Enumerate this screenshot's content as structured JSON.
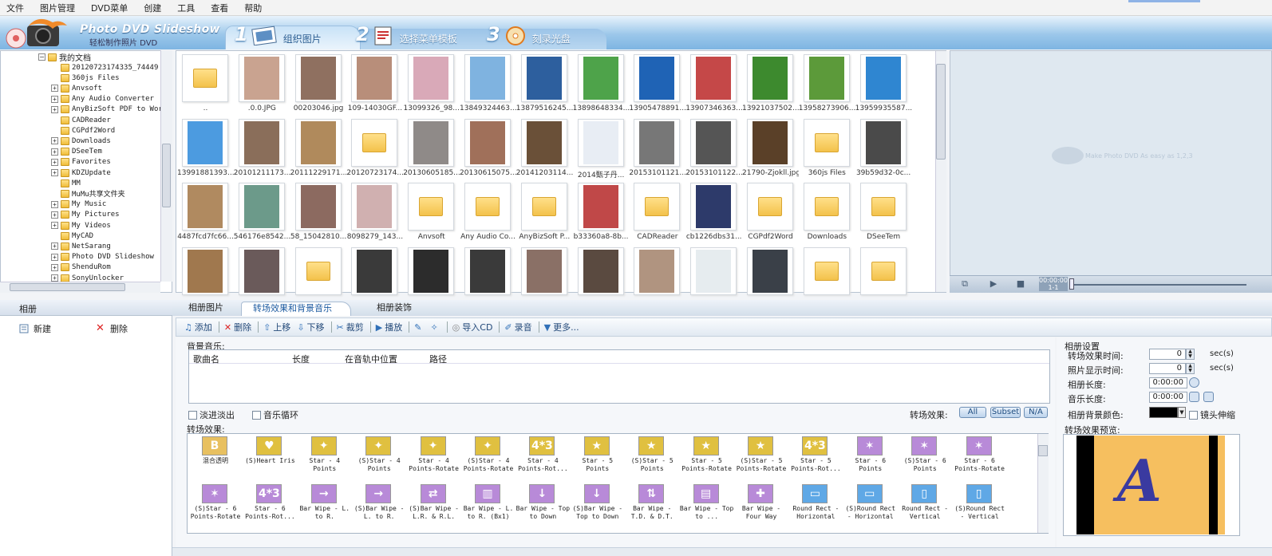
{
  "menu": [
    "文件",
    "图片管理",
    "DVD菜单",
    "创建",
    "工具",
    "查看",
    "帮助"
  ],
  "app": {
    "title": "Photo DVD Slideshow",
    "subtitle": "轻松制作照片 DVD"
  },
  "steps": [
    {
      "num": "1",
      "label": "组织图片"
    },
    {
      "num": "2",
      "label": "选择菜单模板"
    },
    {
      "num": "3",
      "label": "刻录光盘"
    }
  ],
  "tree": {
    "root": "我的文档",
    "items": [
      "20120723174335_74449",
      "360js Files",
      "Anvsoft",
      "Any Audio Converter",
      "AnyBizSoft PDF to Word",
      "CADReader",
      "CGPdf2Word",
      "Downloads",
      "DSeeTem",
      "Favorites",
      "KDZUpdate",
      "MM",
      "MuMu共享文件夹",
      "My Music",
      "My Pictures",
      "My Videos",
      "MyCAD",
      "NetSarang",
      "Photo DVD Slideshow",
      "ShenduRom",
      "SonyUnlocker"
    ]
  },
  "thumbs": [
    {
      "cap": "..",
      "kind": "folder"
    },
    {
      "cap": ".0.0.JPG",
      "kind": "img",
      "color": "#c9a390"
    },
    {
      "cap": "00203046.jpg",
      "kind": "img",
      "color": "#8f7060"
    },
    {
      "cap": "109-14030GF...",
      "kind": "img",
      "color": "#b88e7a"
    },
    {
      "cap": "13099326_98...",
      "kind": "img",
      "color": "#d9a9b8"
    },
    {
      "cap": "13849324463...",
      "kind": "img",
      "color": "#7fb3e0"
    },
    {
      "cap": "13879516245...",
      "kind": "img",
      "color": "#2d5f9e"
    },
    {
      "cap": "13898648334...",
      "kind": "img",
      "color": "#4ea34a"
    },
    {
      "cap": "13905478891...",
      "kind": "img",
      "color": "#1f63b5"
    },
    {
      "cap": "13907346363...",
      "kind": "img",
      "color": "#c54848"
    },
    {
      "cap": "13921037502...",
      "kind": "img",
      "color": "#3d8a2e"
    },
    {
      "cap": "13958273906...",
      "kind": "img",
      "color": "#5c9a3a"
    },
    {
      "cap": "13959935587...",
      "kind": "img",
      "color": "#2f86d1"
    },
    {
      "cap": "13991881393...",
      "kind": "img",
      "color": "#4c9be0"
    },
    {
      "cap": "20101211173...",
      "kind": "img",
      "color": "#8a6e5a"
    },
    {
      "cap": "20111229171...",
      "kind": "img",
      "color": "#b08a5c"
    },
    {
      "cap": "20120723174...",
      "kind": "folder"
    },
    {
      "cap": "20130605185...",
      "kind": "img",
      "color": "#8f8a88"
    },
    {
      "cap": "20130615075...",
      "kind": "img",
      "color": "#a0705a"
    },
    {
      "cap": "20141203114...",
      "kind": "img",
      "color": "#6a5038"
    },
    {
      "cap": "2014甄子丹...",
      "kind": "img",
      "color": "#e8edf4"
    },
    {
      "cap": "20153101121...",
      "kind": "img",
      "color": "#777"
    },
    {
      "cap": "20153101122...",
      "kind": "img",
      "color": "#555"
    },
    {
      "cap": "21790-Zjokll.jpg",
      "kind": "img",
      "color": "#5a4028"
    },
    {
      "cap": "360js Files",
      "kind": "folder"
    },
    {
      "cap": "39b59d32-0c...",
      "kind": "img",
      "color": "#4a4a4a"
    },
    {
      "cap": "4487fcd7fc66...",
      "kind": "img",
      "color": "#b08a60"
    },
    {
      "cap": "546176e8542...",
      "kind": "img",
      "color": "#6c9a8a"
    },
    {
      "cap": "58_15042810...",
      "kind": "img",
      "color": "#8c6a60"
    },
    {
      "cap": "8098279_143...",
      "kind": "img",
      "color": "#d0b0b0"
    },
    {
      "cap": "Anvsoft",
      "kind": "folder"
    },
    {
      "cap": "Any Audio Co...",
      "kind": "folder"
    },
    {
      "cap": "AnyBizSoft P...",
      "kind": "folder"
    },
    {
      "cap": "b33360a8-8b...",
      "kind": "img",
      "color": "#c04848"
    },
    {
      "cap": "CADReader",
      "kind": "folder"
    },
    {
      "cap": "cb1226dbs31...",
      "kind": "img",
      "color": "#2d3a6a"
    },
    {
      "cap": "CGPdf2Word",
      "kind": "folder"
    },
    {
      "cap": "Downloads",
      "kind": "folder"
    },
    {
      "cap": "DSeeTem",
      "kind": "folder"
    },
    {
      "cap": "",
      "kind": "img",
      "color": "#a0784e"
    },
    {
      "cap": "",
      "kind": "img",
      "color": "#6a5a5a"
    },
    {
      "cap": "",
      "kind": "folder"
    },
    {
      "cap": "",
      "kind": "img",
      "color": "#3a3a3a"
    },
    {
      "cap": "",
      "kind": "img",
      "color": "#2c2c2c"
    },
    {
      "cap": "",
      "kind": "img",
      "color": "#3a3a3a"
    },
    {
      "cap": "",
      "kind": "img",
      "color": "#8a7066"
    },
    {
      "cap": "",
      "kind": "img",
      "color": "#5a4a40"
    },
    {
      "cap": "",
      "kind": "img",
      "color": "#b09480"
    },
    {
      "cap": "",
      "kind": "img",
      "color": "#e6ecef"
    },
    {
      "cap": "",
      "kind": "img",
      "color": "#3a4048"
    },
    {
      "cap": "",
      "kind": "folder"
    },
    {
      "cap": "",
      "kind": "folder"
    }
  ],
  "preview": {
    "watermark": "Make Photo DVD As easy as 1,2,3",
    "time": "00:00:00",
    "counter": "1-1"
  },
  "album": {
    "title": "相册",
    "new_label": "新建",
    "delete_label": "删除"
  },
  "tabs": [
    "相册图片",
    "转场效果和背景音乐",
    "相册装饰"
  ],
  "toolbar": [
    "添加",
    "删除",
    "上移",
    "下移",
    "裁剪",
    "播放",
    "导入CD",
    "录音",
    "更多..."
  ],
  "music": {
    "title": "背景音乐:",
    "columns": [
      "歌曲名",
      "长度",
      "在音轨中位置",
      "路径"
    ],
    "fade_label": "淡进淡出",
    "loop_label": "音乐循环",
    "effect_label": "转场效果:",
    "filters": [
      "All",
      "Subset",
      "N/A"
    ]
  },
  "effects": {
    "title": "转场效果:",
    "items": [
      {
        "name": "混合透明",
        "icon": "B",
        "bg": "#e8c060"
      },
      {
        "name": "(S)Heart Iris",
        "icon": "♥",
        "bg": "#e0c040"
      },
      {
        "name": "Star - 4 Points",
        "icon": "✦",
        "bg": "#e0c040"
      },
      {
        "name": "(S)Star - 4 Points",
        "icon": "✦",
        "bg": "#e0c040"
      },
      {
        "name": "Star - 4 Points-Rotate",
        "icon": "✦",
        "bg": "#e0c040"
      },
      {
        "name": "(S)Star - 4 Points-Rotate",
        "icon": "✦",
        "bg": "#e0c040"
      },
      {
        "name": "Star - 4 Points-Rot...",
        "icon": "4*3",
        "bg": "#e0c040"
      },
      {
        "name": "Star - 5 Points",
        "icon": "★",
        "bg": "#e0c040"
      },
      {
        "name": "(S)Star - 5 Points",
        "icon": "★",
        "bg": "#e0c040"
      },
      {
        "name": "Star - 5 Points-Rotate",
        "icon": "★",
        "bg": "#e0c040"
      },
      {
        "name": "(S)Star - 5 Points-Rotate",
        "icon": "★",
        "bg": "#e0c040"
      },
      {
        "name": "Star - 5 Points-Rot...",
        "icon": "4*3",
        "bg": "#e0c040"
      },
      {
        "name": "Star - 6 Points",
        "icon": "✶",
        "bg": "#b88ad8"
      },
      {
        "name": "(S)Star - 6 Points",
        "icon": "✶",
        "bg": "#b88ad8"
      },
      {
        "name": "Star - 6 Points-Rotate",
        "icon": "✶",
        "bg": "#b88ad8"
      },
      {
        "name": "(S)Star - 6 Points-Rotate",
        "icon": "✶",
        "bg": "#b88ad8"
      },
      {
        "name": "Star - 6 Points-Rot...",
        "icon": "4*3",
        "bg": "#b88ad8"
      },
      {
        "name": "Bar Wipe - L. to R.",
        "icon": "→",
        "bg": "#b88ad8"
      },
      {
        "name": "(S)Bar Wipe - L. to R.",
        "icon": "→",
        "bg": "#b88ad8"
      },
      {
        "name": "(S)Bar Wipe - L.R. & R.L.",
        "icon": "⇄",
        "bg": "#b88ad8"
      },
      {
        "name": "Bar Wipe - L. to R. (Bx1)",
        "icon": "▥",
        "bg": "#b88ad8"
      },
      {
        "name": "Bar Wipe - Top to Down",
        "icon": "↓",
        "bg": "#b88ad8"
      },
      {
        "name": "(S)Bar Wipe - Top to Down",
        "icon": "↓",
        "bg": "#b88ad8"
      },
      {
        "name": "Bar Wipe - T.D. & D.T.",
        "icon": "⇅",
        "bg": "#b88ad8"
      },
      {
        "name": "Bar Wipe - Top to ...",
        "icon": "▤",
        "bg": "#b88ad8"
      },
      {
        "name": "Bar Wipe - Four Way",
        "icon": "✚",
        "bg": "#b88ad8"
      },
      {
        "name": "Round Rect - Horizontal",
        "icon": "▭",
        "bg": "#5fa8e6"
      },
      {
        "name": "(S)Round Rect - Horizontal",
        "icon": "▭",
        "bg": "#5fa8e6"
      },
      {
        "name": "Round Rect - Vertical",
        "icon": "▯",
        "bg": "#5fa8e6"
      },
      {
        "name": "(S)Round Rect - Vertical",
        "icon": "▯",
        "bg": "#5fa8e6"
      }
    ]
  },
  "settings": {
    "title": "相册设置",
    "rows": [
      {
        "label": "转场效果时间:",
        "value": "0",
        "unit": "sec(s)"
      },
      {
        "label": "照片显示时间:",
        "value": "0",
        "unit": "sec(s)"
      },
      {
        "label": "相册长度:",
        "value": "0:00:00",
        "unit": ""
      },
      {
        "label": "音乐长度:",
        "value": "0:00:00",
        "unit": ""
      }
    ],
    "bg_color_label": "相册背景颜色:",
    "bg_color": "#000000",
    "camera_label": "镜头伸缩",
    "preview_title": "转场效果预览:",
    "preview_letter": "A"
  },
  "colors": {
    "accent": "#7eb5e2",
    "banner_light": "#e8f3fc",
    "preview_bg": "#f6bf5f"
  }
}
